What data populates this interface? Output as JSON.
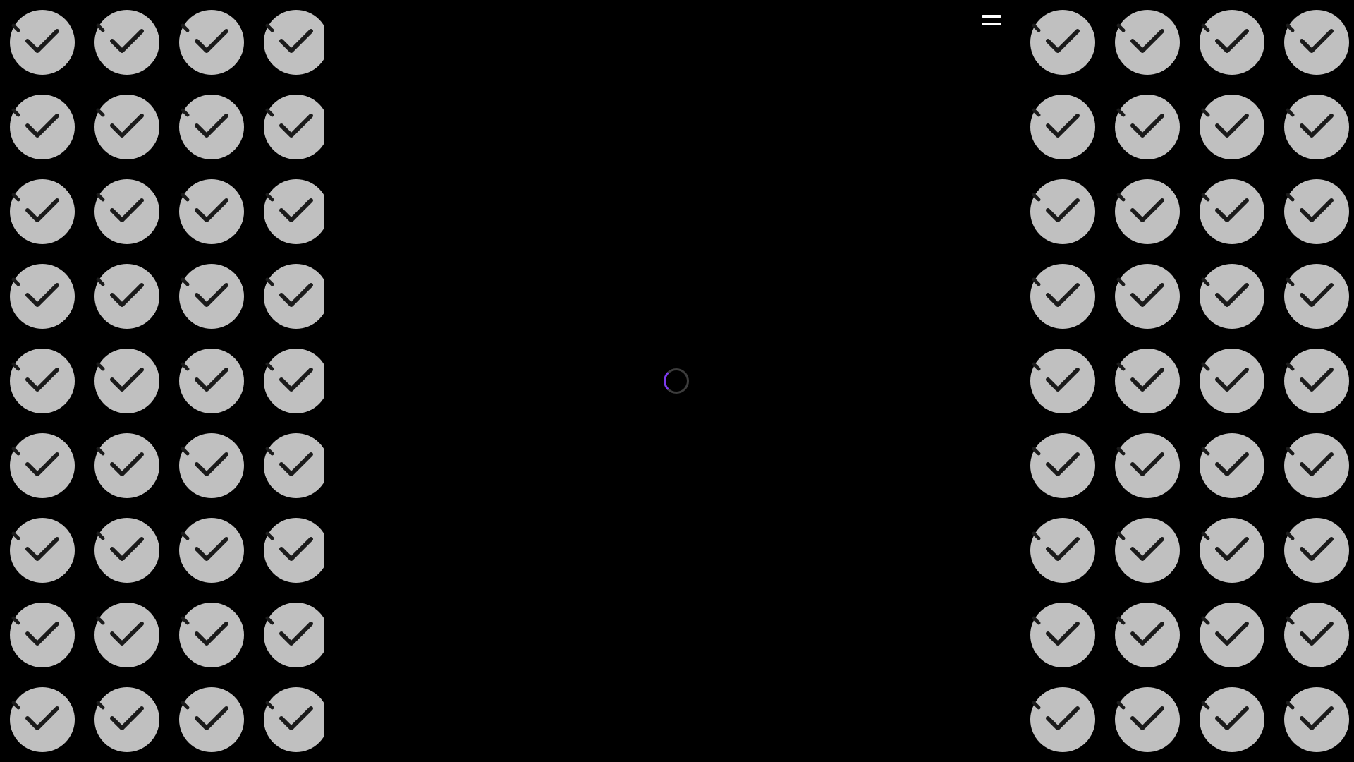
{
  "colors": {
    "background": "#000000",
    "tile": "#c0c0c0",
    "check": "#1a1a1a",
    "menu_icon": "#ffffff",
    "spinner_track": "#3c3c3c",
    "spinner_accent": "#7c3aed"
  },
  "icons": {
    "menu": "hamburger-menu-icon",
    "tile": "checkmark-circle-icon",
    "loading": "loading-spinner-icon"
  },
  "left_panel": {
    "rows": 9,
    "columns": 4,
    "tile_state": "checked"
  },
  "right_panel": {
    "rows": 9,
    "columns": 4,
    "tile_state": "checked"
  }
}
